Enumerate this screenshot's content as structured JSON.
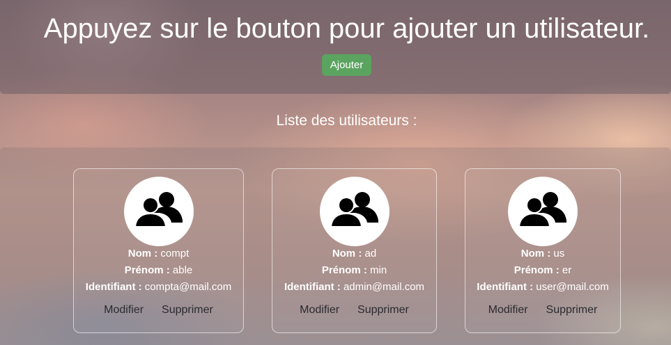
{
  "header": {
    "title": "Appuyez sur le bouton pour ajouter un utilisateur.",
    "add_button_label": "Ajouter"
  },
  "list": {
    "heading": "Liste des utilisateurs :",
    "labels": {
      "nom": "Nom :",
      "prenom": "Prénom :",
      "identifiant": "Identifiant :",
      "modifier": "Modifier",
      "supprimer": "Supprimer"
    },
    "users": [
      {
        "nom": "compt",
        "prenom": "able",
        "identifiant": "compta@mail.com"
      },
      {
        "nom": "ad",
        "prenom": "min",
        "identifiant": "admin@mail.com"
      },
      {
        "nom": "us",
        "prenom": "er",
        "identifiant": "user@mail.com"
      }
    ]
  },
  "icons": {
    "avatar": "users-group-icon"
  },
  "colors": {
    "add_button": "#5ba460",
    "text": "#ffffff",
    "action_text": "#2a2a30"
  }
}
